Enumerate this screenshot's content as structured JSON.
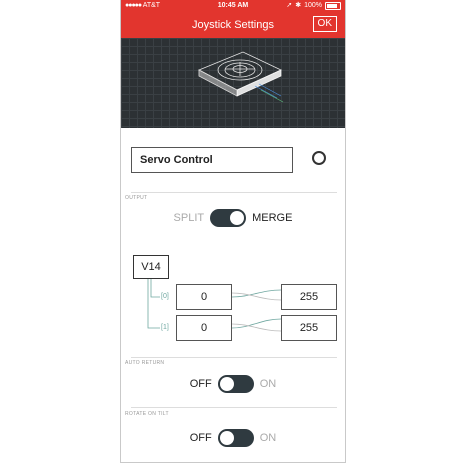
{
  "status": {
    "carrier": "AT&T",
    "time": "10:45 AM",
    "battery": "100%"
  },
  "header": {
    "title": "Joystick Settings",
    "ok_label": "OK"
  },
  "widget": {
    "name": "Servo Control"
  },
  "output": {
    "section_label": "OUTPUT",
    "split_label": "SPLIT",
    "merge_label": "MERGE",
    "pin": "V14",
    "rows": [
      {
        "index": "[0]",
        "min": "0",
        "max": "255"
      },
      {
        "index": "[1]",
        "min": "0",
        "max": "255"
      }
    ]
  },
  "auto_return": {
    "section_label": "AUTO RETURN",
    "off_label": "OFF",
    "on_label": "ON"
  },
  "rotate_on_tilt": {
    "section_label": "ROTATE ON TILT",
    "off_label": "OFF",
    "on_label": "ON"
  },
  "colors": {
    "header_red": "#e2352e",
    "hero_bg": "#2c3134",
    "switch_dark": "#2f3a40",
    "wire_teal": "#6fa7a0"
  }
}
